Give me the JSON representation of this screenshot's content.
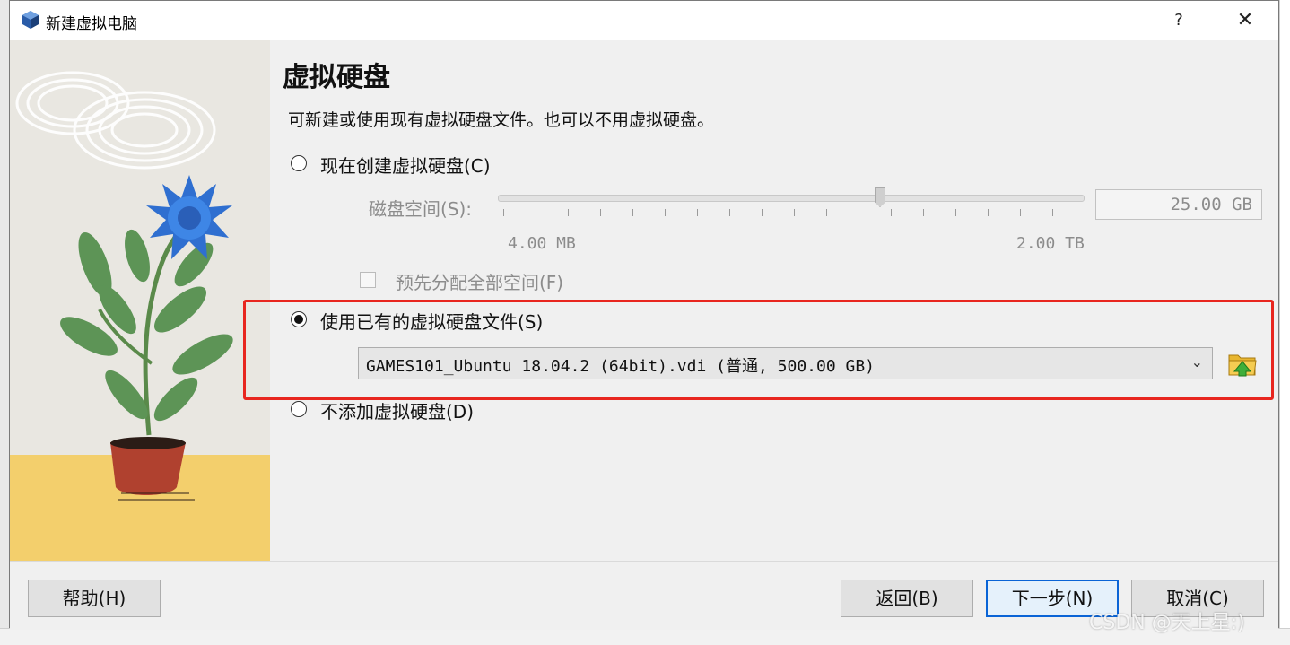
{
  "window": {
    "title": "新建虚拟电脑",
    "help_glyph": "?",
    "close_glyph": "✕"
  },
  "page": {
    "title": "虚拟硬盘",
    "description": "可新建或使用现有虚拟硬盘文件。也可以不用虚拟硬盘。"
  },
  "options": {
    "create_new": {
      "label": "现在创建虚拟硬盘(C)",
      "checked": false
    },
    "disk_size": {
      "label": "磁盘空间(S):",
      "value": "25.00 GB",
      "min_label": "4.00 MB",
      "max_label": "2.00 TB",
      "tick_count": 19
    },
    "preallocate": {
      "label": "预先分配全部空间(F)",
      "checked": false
    },
    "use_existing": {
      "label": "使用已有的虚拟硬盘文件(S)",
      "checked": true,
      "selected_file": "GAMES101_Ubuntu 18.04.2 (64bit).vdi (普通, 500.00 GB)",
      "dropdown_icon": "chevron-down-icon",
      "browse_icon": "folder-open-icon"
    },
    "no_disk": {
      "label": "不添加虚拟硬盘(D)",
      "checked": false
    }
  },
  "buttons": {
    "help": "帮助(H)",
    "back": "返回(B)",
    "next": "下一步(N)",
    "cancel": "取消(C)"
  },
  "watermark": "CSDN @天上星:)",
  "colors": {
    "highlight_box": "#e8261f",
    "default_button_border": "#0a64d6"
  }
}
